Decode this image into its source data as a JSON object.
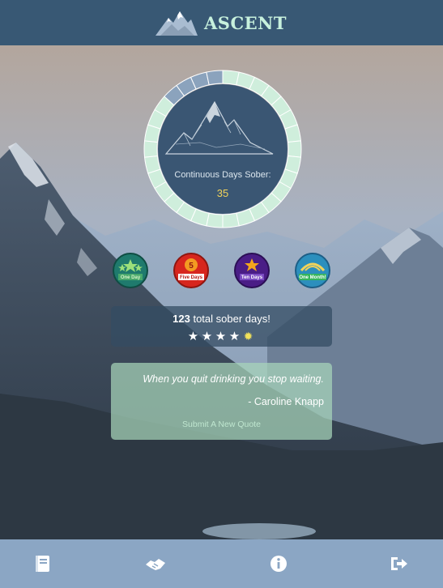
{
  "header": {
    "app_name": "ASCENT"
  },
  "progress_ring": {
    "label": "Continuous Days Sober:",
    "value": "35",
    "segments_total": 30,
    "segments_remaining": 4,
    "filled_color": "#cfeedc",
    "empty_color": "#8ba3bd"
  },
  "badges": [
    {
      "label": "One Day",
      "color": "#1f7a6d",
      "icon": "stars-badge-icon"
    },
    {
      "label": "Five Days",
      "color": "#d7261e",
      "icon": "five-badge-icon"
    },
    {
      "label": "Ten Days",
      "color": "#4a1d86",
      "icon": "star-trophy-badge-icon"
    },
    {
      "label": "One Month!",
      "color": "#2c8fbd",
      "icon": "banner-badge-icon"
    }
  ],
  "totals": {
    "count": "123",
    "suffix": " total sober days!",
    "stars": 4,
    "sun_icon": "sun-icon"
  },
  "quote": {
    "text": "When you quit drinking you stop waiting.",
    "author": "- Caroline Knapp",
    "submit_label": "Submit A New Quote"
  },
  "footer": {
    "icons": [
      "journal-icon",
      "handshake-icon",
      "info-icon",
      "logout-icon"
    ]
  },
  "colors": {
    "header_bg": "#385874",
    "footer_bg": "#8ba6c4",
    "accent_mint": "#c7f1dd",
    "accent_gold": "#f2d35a"
  }
}
